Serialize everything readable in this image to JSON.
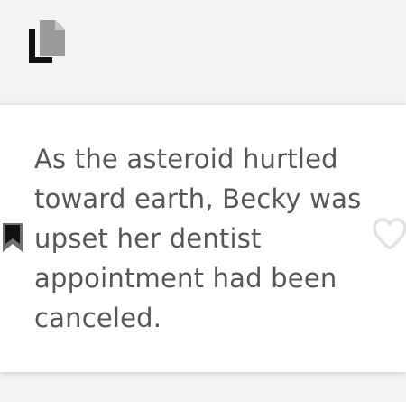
{
  "header": {
    "copy_icon": "copy-icon"
  },
  "card": {
    "text": "As the asteroid hurtled toward earth, Becky was upset her dentist appointment had been canceled.",
    "bookmark_icon": "bookmark-icon",
    "like_icon": "heart-outline-icon"
  },
  "colors": {
    "background": "#f3f3f3",
    "card": "#ffffff",
    "text": "#575757",
    "icon_dark": "#111111",
    "icon_gray": "#9a9a9a",
    "heart_outline": "#e2e2e2"
  }
}
